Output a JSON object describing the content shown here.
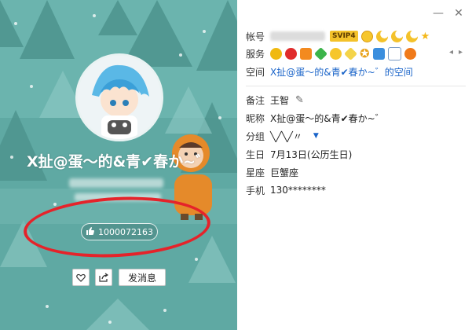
{
  "profile": {
    "display_name": "X扯@蛋～的&青✔春か~゛",
    "likes_count": "1000072163",
    "message_button": "发消息"
  },
  "info": {
    "account": {
      "label": "帐号",
      "vip_badge": "SVIP4"
    },
    "services": {
      "label": "服务"
    },
    "space": {
      "label": "空间",
      "link": "X扯@蛋～的&青✔春か~゛的空间"
    },
    "remark": {
      "label": "备注",
      "value": "王智"
    },
    "nickname": {
      "label": "昵称",
      "value": "X扯@蛋～的&青✔春か~゛"
    },
    "group": {
      "label": "分组",
      "value": "╲╱╲╱〃"
    },
    "birthday": {
      "label": "生日",
      "value": "7月13日(公历生日)"
    },
    "zodiac": {
      "label": "星座",
      "value": "巨蟹座"
    },
    "phone": {
      "label": "手机",
      "value": "130********"
    }
  },
  "window": {
    "minimize": "—",
    "close": "✕"
  },
  "icons": {
    "level": [
      "sun-icon",
      "moon-icon",
      "moon-icon",
      "moon-icon",
      "star-icon"
    ],
    "services": [
      "qq-penguin-icon",
      "qq-icon",
      "heart-gem-icon",
      "diamond-green-icon",
      "game-icon",
      "diamond-yellow-icon",
      "star-badge-icon",
      "photo-icon",
      "mail-icon",
      "music-icon"
    ]
  },
  "colors": {
    "accent": "#1a64c9",
    "panel_bg": "#5fa9a3",
    "highlight_circle": "#e5232a"
  }
}
